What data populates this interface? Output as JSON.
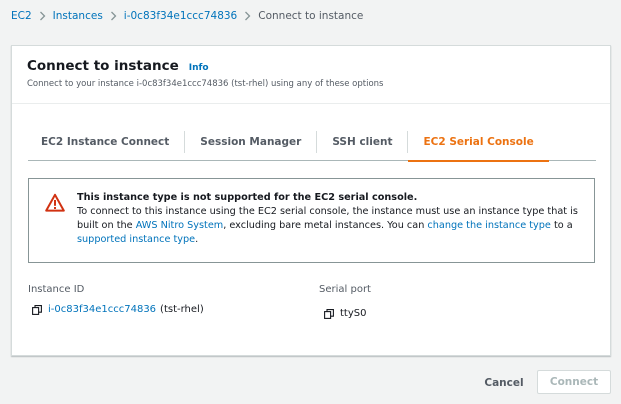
{
  "breadcrumb": {
    "items": [
      "EC2",
      "Instances",
      "i-0c83f34e1ccc74836",
      "Connect to instance"
    ]
  },
  "panel": {
    "title": "Connect to instance",
    "info_label": "Info",
    "description": "Connect to your instance i-0c83f34e1ccc74836 (tst-rhel) using any of these options"
  },
  "tabs": [
    {
      "label": "EC2 Instance Connect",
      "active": false
    },
    {
      "label": "Session Manager",
      "active": false
    },
    {
      "label": "SSH client",
      "active": false
    },
    {
      "label": "EC2 Serial Console",
      "active": true
    }
  ],
  "alert": {
    "title": "This instance type is not supported for the EC2 serial console.",
    "text_1": "To connect to this instance using the EC2 serial console, the instance must use an instance type that is built on the ",
    "link_nitro": "AWS Nitro System",
    "text_2": ", excluding bare metal instances. You can ",
    "link_change_type": "change the instance type",
    "text_3": " to a ",
    "link_supported": "supported instance type",
    "text_4": "."
  },
  "instance": {
    "label": "Instance ID",
    "id": "i-0c83f34e1ccc74836",
    "name": "(tst-rhel)"
  },
  "serial_port": {
    "label": "Serial port",
    "value": "ttyS0"
  },
  "footer": {
    "cancel_label": "Cancel",
    "connect_label": "Connect"
  },
  "colors": {
    "link": "#0073bb",
    "active_tab": "#ec7211",
    "warning_icon": "#d13212",
    "disabled_text": "#aab7b8"
  }
}
